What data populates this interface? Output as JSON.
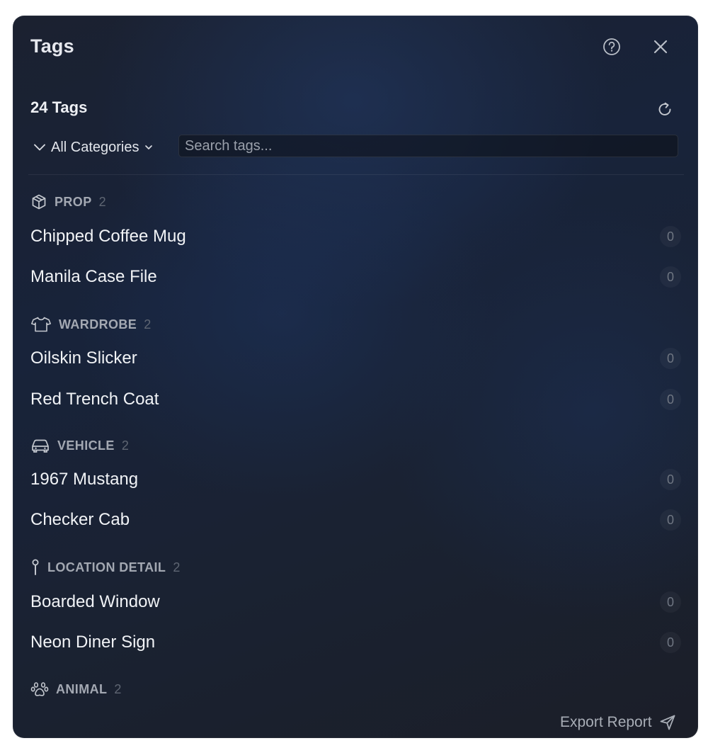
{
  "header": {
    "title": "Tags",
    "help_icon": "help-circle-icon",
    "close_icon": "close-icon"
  },
  "toolbar": {
    "count_title": "24 Tags",
    "refresh_icon": "refresh-icon",
    "category_filter": "All Categories",
    "search_placeholder": "Search tags...",
    "search_value": ""
  },
  "categories": [
    {
      "name": "PROP",
      "count": "2",
      "icon": "box-icon",
      "tags": [
        {
          "name": "Chipped Coffee Mug",
          "count": "0"
        },
        {
          "name": "Manila Case File",
          "count": "0"
        }
      ]
    },
    {
      "name": "WARDROBE",
      "count": "2",
      "icon": "shirt-icon",
      "tags": [
        {
          "name": "Oilskin Slicker",
          "count": "0"
        },
        {
          "name": "Red Trench Coat",
          "count": "0"
        }
      ]
    },
    {
      "name": "VEHICLE",
      "count": "2",
      "icon": "car-icon",
      "tags": [
        {
          "name": "1967 Mustang",
          "count": "0"
        },
        {
          "name": "Checker Cab",
          "count": "0"
        }
      ]
    },
    {
      "name": "LOCATION DETAIL",
      "count": "2",
      "icon": "pin-icon",
      "tags": [
        {
          "name": "Boarded Window",
          "count": "0"
        },
        {
          "name": "Neon Diner Sign",
          "count": "0"
        }
      ]
    },
    {
      "name": "ANIMAL",
      "count": "2",
      "icon": "paw-icon",
      "tags": []
    }
  ],
  "footer": {
    "export_label": "Export Report",
    "export_icon": "send-icon"
  },
  "colors": {
    "panel_bg": "#1a2232",
    "text_primary": "#f1f3f6",
    "text_muted": "#a3a8b2"
  }
}
